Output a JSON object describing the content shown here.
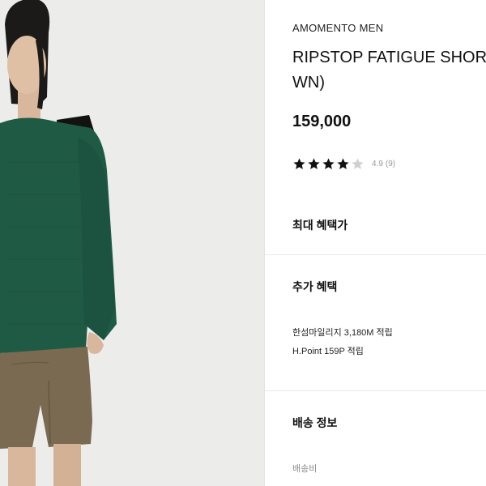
{
  "product": {
    "brand": "AMOMENTO MEN",
    "title_line1": "RIPSTOP FATIGUE SHORTS (BRO",
    "title_line2": "WN)",
    "price": "159,000",
    "rating": {
      "stars_filled": 4,
      "stars_total": 5,
      "score": "4.9",
      "count": "(9)"
    }
  },
  "sections": {
    "max_benefit_title": "최대 혜택가",
    "extra_benefit_title": "추가 혜택",
    "extra_benefits": [
      "한섬마일리지 3,180M 적립",
      "H.Point 159P 적립"
    ],
    "shipping_title": "배송 정보",
    "shipping_fee_label": "배송비"
  },
  "colors": {
    "photo_background": "#ececeb",
    "sweater": "#1f5a45",
    "shorts": "#7a6a52",
    "star_filled": "#111111",
    "star_empty": "#d0d0d0",
    "muted_text": "#9a9a9a"
  }
}
